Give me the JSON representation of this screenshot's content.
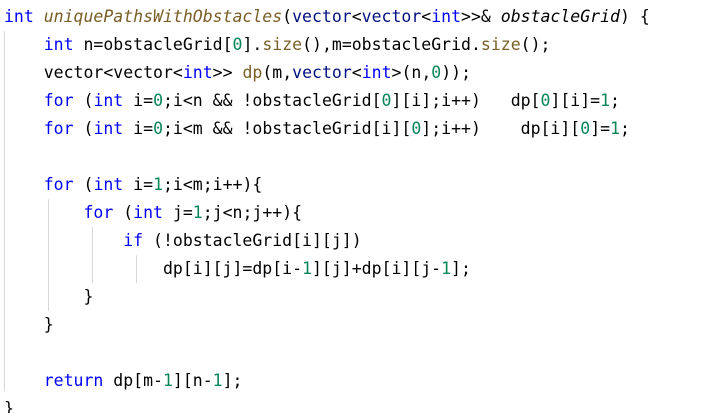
{
  "colors": {
    "background": "#ffffff",
    "keyword": "#0000ff",
    "type": "#0000ff",
    "function": "#795e26",
    "number": "#098658",
    "identifier": "#000000",
    "container": "#001080",
    "indent_guide": "#d6d6d6"
  },
  "code": {
    "lines": [
      [
        {
          "t": "int",
          "c": "kw"
        },
        {
          "t": " ",
          "c": "sp"
        },
        {
          "t": "uniquePathsWithObstacles",
          "c": "fn it"
        },
        {
          "t": "(",
          "c": "id"
        },
        {
          "t": "vector",
          "c": "ct"
        },
        {
          "t": "<",
          "c": "id"
        },
        {
          "t": "vector",
          "c": "ct"
        },
        {
          "t": "<",
          "c": "id"
        },
        {
          "t": "int",
          "c": "kw"
        },
        {
          "t": ">>& ",
          "c": "id"
        },
        {
          "t": "obstacleGrid",
          "c": "id it"
        },
        {
          "t": ") {",
          "c": "id"
        }
      ],
      [
        {
          "t": "    ",
          "c": "sp"
        },
        {
          "t": "int",
          "c": "kw"
        },
        {
          "t": " n=obstacleGrid[",
          "c": "id"
        },
        {
          "t": "0",
          "c": "num"
        },
        {
          "t": "].",
          "c": "id"
        },
        {
          "t": "size",
          "c": "fn"
        },
        {
          "t": "(),m=obstacleGrid.",
          "c": "id"
        },
        {
          "t": "size",
          "c": "fn"
        },
        {
          "t": "();",
          "c": "id"
        }
      ],
      [
        {
          "t": "    ",
          "c": "sp"
        },
        {
          "t": "vector",
          "c": "id"
        },
        {
          "t": "<",
          "c": "id"
        },
        {
          "t": "vector",
          "c": "id"
        },
        {
          "t": "<",
          "c": "id"
        },
        {
          "t": "int",
          "c": "kw"
        },
        {
          "t": ">> ",
          "c": "id"
        },
        {
          "t": "dp",
          "c": "fn"
        },
        {
          "t": "(m,",
          "c": "id"
        },
        {
          "t": "vector",
          "c": "ct"
        },
        {
          "t": "<",
          "c": "id"
        },
        {
          "t": "int",
          "c": "kw"
        },
        {
          "t": ">(n,",
          "c": "id"
        },
        {
          "t": "0",
          "c": "num"
        },
        {
          "t": "));",
          "c": "id"
        }
      ],
      [
        {
          "t": "    ",
          "c": "sp"
        },
        {
          "t": "for",
          "c": "kw"
        },
        {
          "t": " (",
          "c": "id"
        },
        {
          "t": "int",
          "c": "kw"
        },
        {
          "t": " i=",
          "c": "id"
        },
        {
          "t": "0",
          "c": "num"
        },
        {
          "t": ";i<n && !obstacleGrid[",
          "c": "id"
        },
        {
          "t": "0",
          "c": "num"
        },
        {
          "t": "][i];i++)   dp[",
          "c": "id"
        },
        {
          "t": "0",
          "c": "num"
        },
        {
          "t": "][i]=",
          "c": "id"
        },
        {
          "t": "1",
          "c": "num"
        },
        {
          "t": ";",
          "c": "id"
        }
      ],
      [
        {
          "t": "    ",
          "c": "sp"
        },
        {
          "t": "for",
          "c": "kw"
        },
        {
          "t": " (",
          "c": "id"
        },
        {
          "t": "int",
          "c": "kw"
        },
        {
          "t": " i=",
          "c": "id"
        },
        {
          "t": "0",
          "c": "num"
        },
        {
          "t": ";i<m && !obstacleGrid[i][",
          "c": "id"
        },
        {
          "t": "0",
          "c": "num"
        },
        {
          "t": "];i++)    dp[i][",
          "c": "id"
        },
        {
          "t": "0",
          "c": "num"
        },
        {
          "t": "]=",
          "c": "id"
        },
        {
          "t": "1",
          "c": "num"
        },
        {
          "t": ";",
          "c": "id"
        }
      ],
      [],
      [
        {
          "t": "    ",
          "c": "sp"
        },
        {
          "t": "for",
          "c": "kw"
        },
        {
          "t": " (",
          "c": "id"
        },
        {
          "t": "int",
          "c": "kw"
        },
        {
          "t": " i=",
          "c": "id"
        },
        {
          "t": "1",
          "c": "num"
        },
        {
          "t": ";i<m;i++){",
          "c": "id"
        }
      ],
      [
        {
          "t": "        ",
          "c": "sp"
        },
        {
          "t": "for",
          "c": "kw"
        },
        {
          "t": " (",
          "c": "id"
        },
        {
          "t": "int",
          "c": "kw"
        },
        {
          "t": " j=",
          "c": "id"
        },
        {
          "t": "1",
          "c": "num"
        },
        {
          "t": ";j<n;j++){",
          "c": "id"
        }
      ],
      [
        {
          "t": "            ",
          "c": "sp"
        },
        {
          "t": "if",
          "c": "kw"
        },
        {
          "t": " (!obstacleGrid[i][j])",
          "c": "id"
        }
      ],
      [
        {
          "t": "                ",
          "c": "sp"
        },
        {
          "t": "dp[i][j]=dp[i-",
          "c": "id"
        },
        {
          "t": "1",
          "c": "num"
        },
        {
          "t": "][j]+dp[i][j-",
          "c": "id"
        },
        {
          "t": "1",
          "c": "num"
        },
        {
          "t": "];",
          "c": "id"
        }
      ],
      [
        {
          "t": "        ",
          "c": "sp"
        },
        {
          "t": "}",
          "c": "id"
        }
      ],
      [
        {
          "t": "    ",
          "c": "sp"
        },
        {
          "t": "}",
          "c": "id"
        }
      ],
      [],
      [
        {
          "t": "    ",
          "c": "sp"
        },
        {
          "t": "return",
          "c": "kw"
        },
        {
          "t": " dp[m-",
          "c": "id"
        },
        {
          "t": "1",
          "c": "num"
        },
        {
          "t": "][n-",
          "c": "id"
        },
        {
          "t": "1",
          "c": "num"
        },
        {
          "t": "];",
          "c": "id"
        }
      ],
      [
        {
          "t": "}",
          "c": "id"
        }
      ]
    ]
  }
}
